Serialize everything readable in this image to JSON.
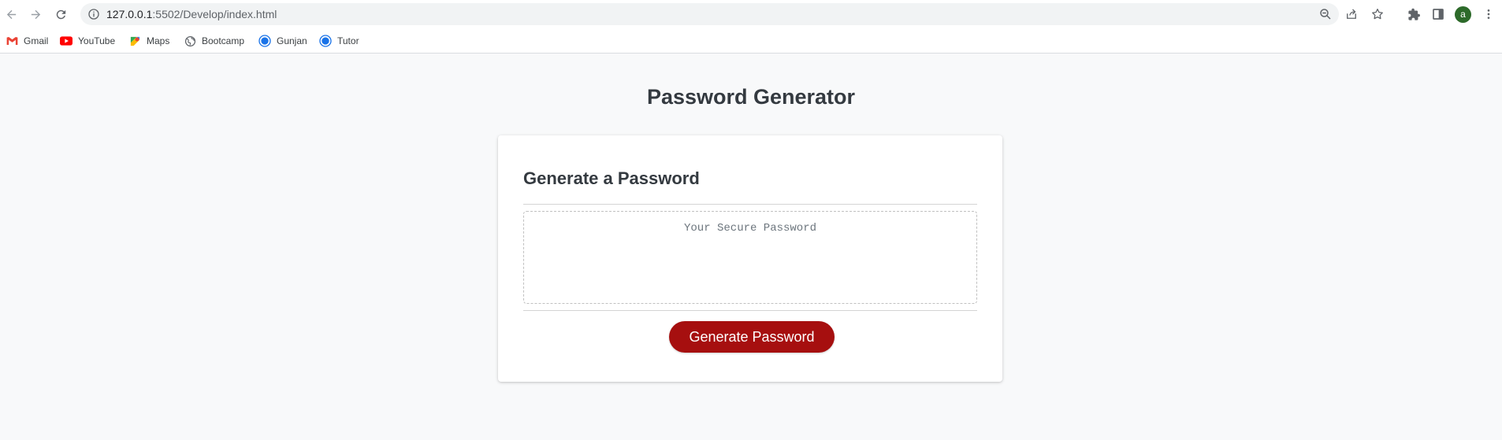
{
  "browser": {
    "url_host": "127.0.0.1",
    "url_path": ":5502/Develop/index.html",
    "avatar_letter": "a",
    "accent_color": "#1a73e8"
  },
  "bookmarks": [
    {
      "label": "Gmail",
      "icon": "gmail-icon"
    },
    {
      "label": "YouTube",
      "icon": "youtube-icon"
    },
    {
      "label": "Maps",
      "icon": "maps-icon"
    },
    {
      "label": "Bootcamp",
      "icon": "globe-icon"
    },
    {
      "label": "Gunjan",
      "icon": "circle-icon"
    },
    {
      "label": "Tutor",
      "icon": "circle-icon"
    }
  ],
  "page": {
    "title": "Password Generator",
    "card_title": "Generate a Password",
    "password_placeholder": "Your Secure Password",
    "password_value": "",
    "generate_label": "Generate Password",
    "button_color": "#a60f0f",
    "text_color": "#343a40"
  }
}
